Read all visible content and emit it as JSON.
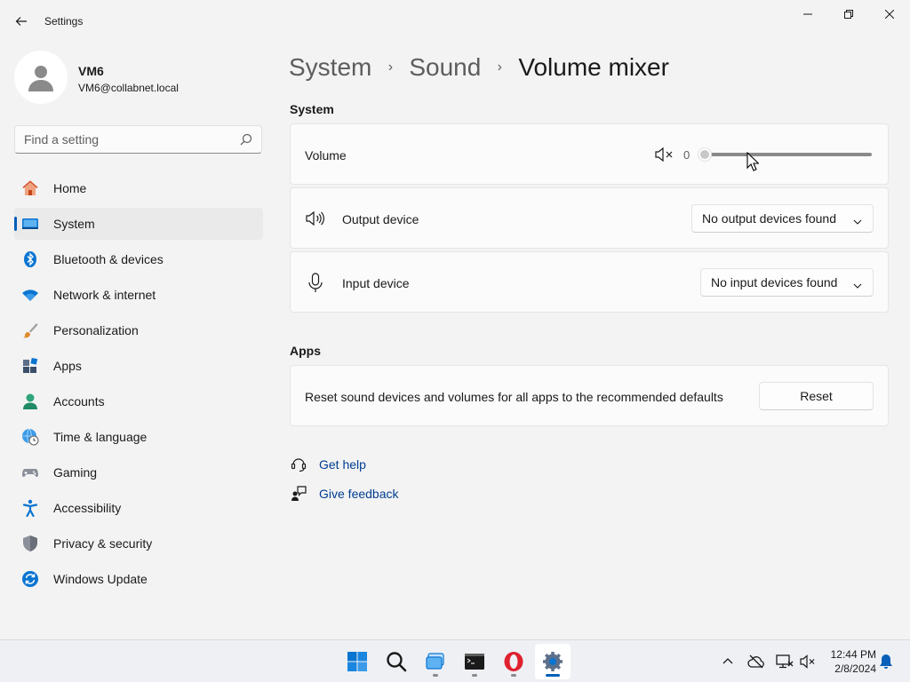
{
  "window": {
    "title": "Settings"
  },
  "profile": {
    "name": "VM6",
    "email": "VM6@collabnet.local"
  },
  "search": {
    "placeholder": "Find a setting"
  },
  "sidebar": {
    "items": [
      {
        "label": "Home",
        "icon": "home-icon"
      },
      {
        "label": "System",
        "icon": "system-icon",
        "active": true
      },
      {
        "label": "Bluetooth & devices",
        "icon": "bluetooth-icon"
      },
      {
        "label": "Network & internet",
        "icon": "wifi-icon"
      },
      {
        "label": "Personalization",
        "icon": "brush-icon"
      },
      {
        "label": "Apps",
        "icon": "apps-icon"
      },
      {
        "label": "Accounts",
        "icon": "accounts-icon"
      },
      {
        "label": "Time & language",
        "icon": "globe-clock-icon"
      },
      {
        "label": "Gaming",
        "icon": "gamepad-icon"
      },
      {
        "label": "Accessibility",
        "icon": "accessibility-icon"
      },
      {
        "label": "Privacy & security",
        "icon": "shield-icon"
      },
      {
        "label": "Windows Update",
        "icon": "update-icon"
      }
    ]
  },
  "breadcrumb": {
    "items": [
      "System",
      "Sound",
      "Volume mixer"
    ],
    "separator": "›"
  },
  "system_section": {
    "heading": "System",
    "volume": {
      "label": "Volume",
      "value": "0",
      "level": 0
    },
    "output": {
      "label": "Output device",
      "selected": "No output devices found"
    },
    "input": {
      "label": "Input device",
      "selected": "No input devices found"
    }
  },
  "apps_section": {
    "heading": "Apps",
    "reset_text": "Reset sound devices and volumes for all apps to the recommended defaults",
    "reset_button": "Reset"
  },
  "links": {
    "help": "Get help",
    "feedback": "Give feedback"
  },
  "taskbar": {
    "apps": [
      "start-icon",
      "search-icon",
      "task-view-icon",
      "terminal-icon",
      "opera-icon",
      "settings-icon"
    ],
    "clock": {
      "time": "12:44 PM",
      "date": "2/8/2024"
    }
  },
  "colors": {
    "accent": "#005fb8",
    "link": "#003e92",
    "background": "#f3f3f3",
    "card": "#fbfbfb"
  }
}
